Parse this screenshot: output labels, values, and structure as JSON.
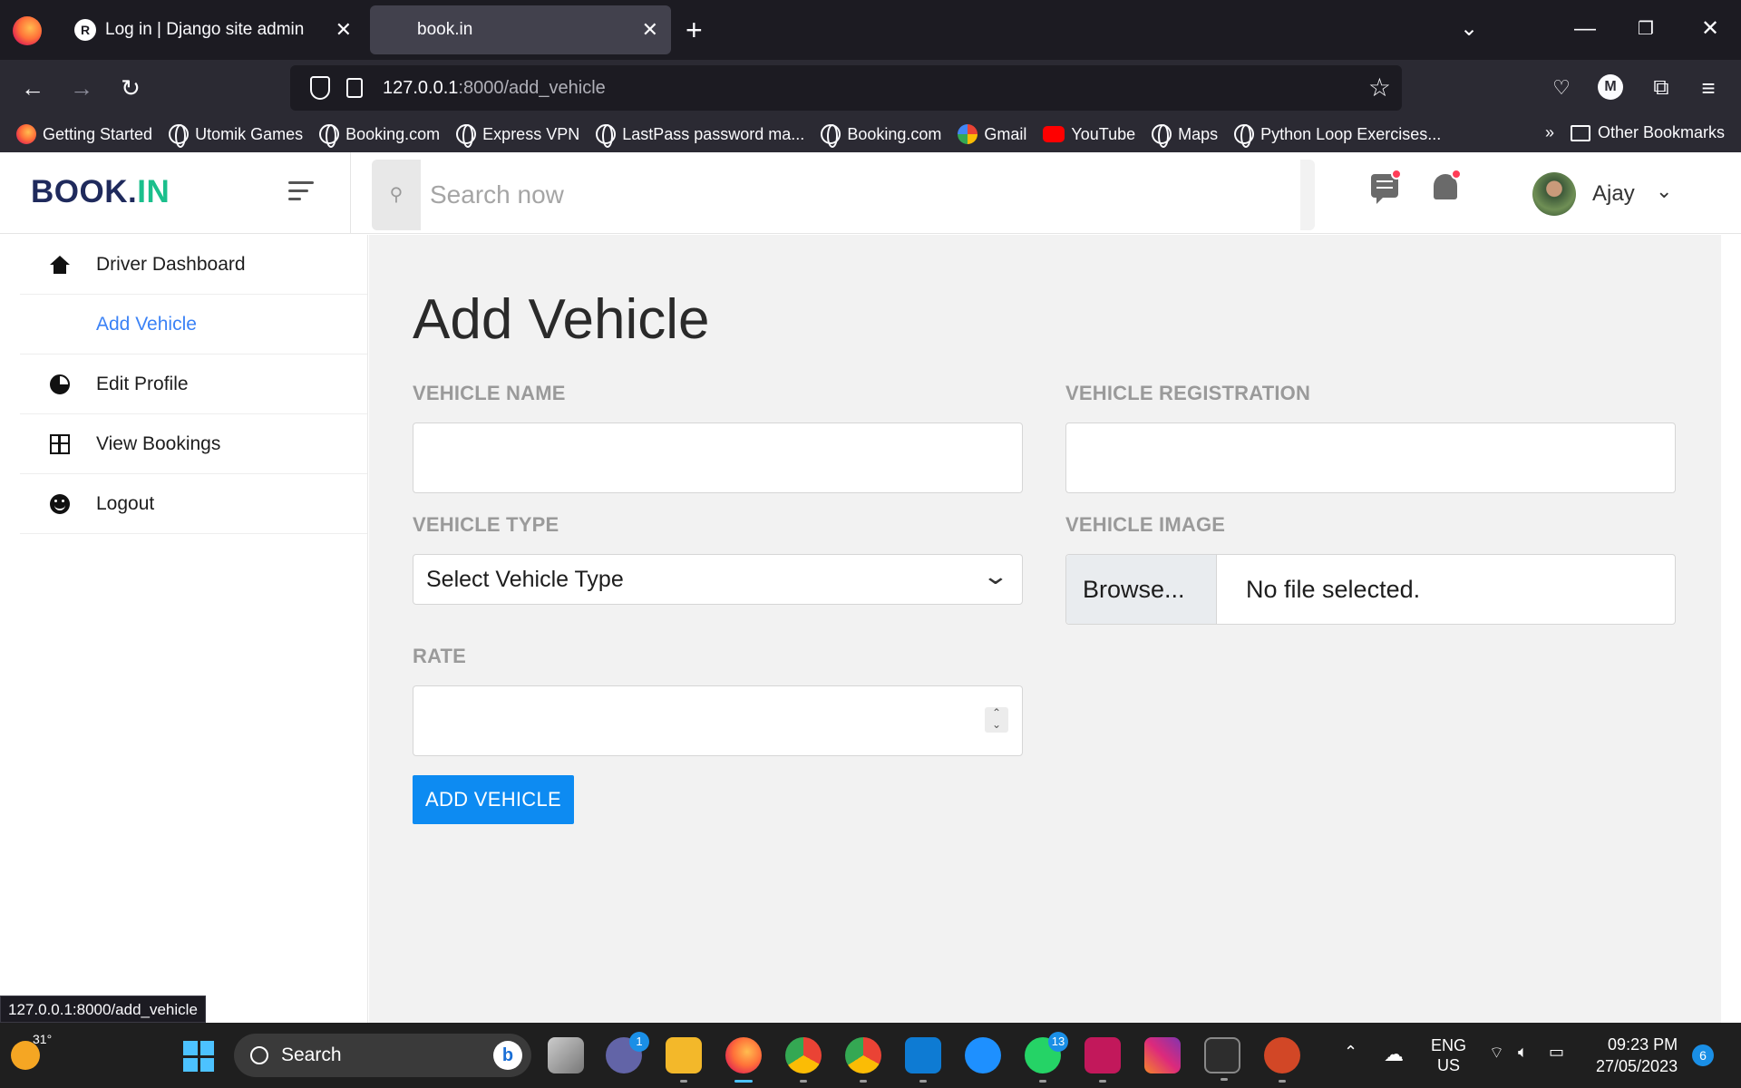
{
  "browser": {
    "tabs": [
      {
        "title": "Log in | Django site admin",
        "active": false
      },
      {
        "title": "book.in",
        "active": true
      }
    ],
    "url_host": "127.0.0.1",
    "url_path": ":8000/add_vehicle",
    "bookmarks": [
      {
        "label": "Getting Started",
        "icon": "firefox-icon"
      },
      {
        "label": "Utomik Games",
        "icon": "globe-icon"
      },
      {
        "label": "Booking.com",
        "icon": "globe-icon"
      },
      {
        "label": "Express VPN",
        "icon": "globe-icon"
      },
      {
        "label": "LastPass password ma...",
        "icon": "globe-icon"
      },
      {
        "label": "Booking.com",
        "icon": "globe-icon"
      },
      {
        "label": "Gmail",
        "icon": "google-icon"
      },
      {
        "label": "YouTube",
        "icon": "youtube-icon"
      },
      {
        "label": "Maps",
        "icon": "globe-icon"
      },
      {
        "label": "Python Loop Exercises...",
        "icon": "globe-icon"
      }
    ],
    "other_bookmarks": "Other Bookmarks",
    "account_initial": "M",
    "status_url": "127.0.0.1:8000/add_vehicle"
  },
  "header": {
    "brand_main": "BOOK.",
    "brand_accent": "IN",
    "search_placeholder": "Search now",
    "username": "Ajay"
  },
  "sidebar": {
    "items": [
      {
        "label": "Driver Dashboard",
        "icon": "home-icon"
      },
      {
        "label": "Add Vehicle",
        "icon": "list-icon",
        "active": true
      },
      {
        "label": "Edit Profile",
        "icon": "pie-chart-icon"
      },
      {
        "label": "View Bookings",
        "icon": "grid-icon"
      },
      {
        "label": "Logout",
        "icon": "smile-icon"
      }
    ]
  },
  "form": {
    "title": "Add Vehicle",
    "vehicle_name_label": "VEHICLE NAME",
    "vehicle_registration_label": "VEHICLE REGISTRATION",
    "vehicle_type_label": "VEHICLE TYPE",
    "vehicle_type_value": "Select Vehicle Type",
    "vehicle_image_label": "VEHICLE IMAGE",
    "browse_label": "Browse...",
    "no_file_label": "No file selected.",
    "rate_label": "RATE",
    "submit_label": "ADD VEHICLE"
  },
  "taskbar": {
    "weather_temp": "31°",
    "search_label": "Search",
    "teams_badge": "1",
    "whatsapp_badge": "13",
    "lang_line1": "ENG",
    "lang_line2": "US",
    "time": "09:23 PM",
    "date": "27/05/2023",
    "notification_count": "6"
  },
  "colors": {
    "accent_blue": "#0d8bf2",
    "sidebar_active": "#3b82f6",
    "brand_navy": "#1f2a5c",
    "brand_green": "#1bbf8c",
    "notification_dot": "#ff3d57"
  }
}
